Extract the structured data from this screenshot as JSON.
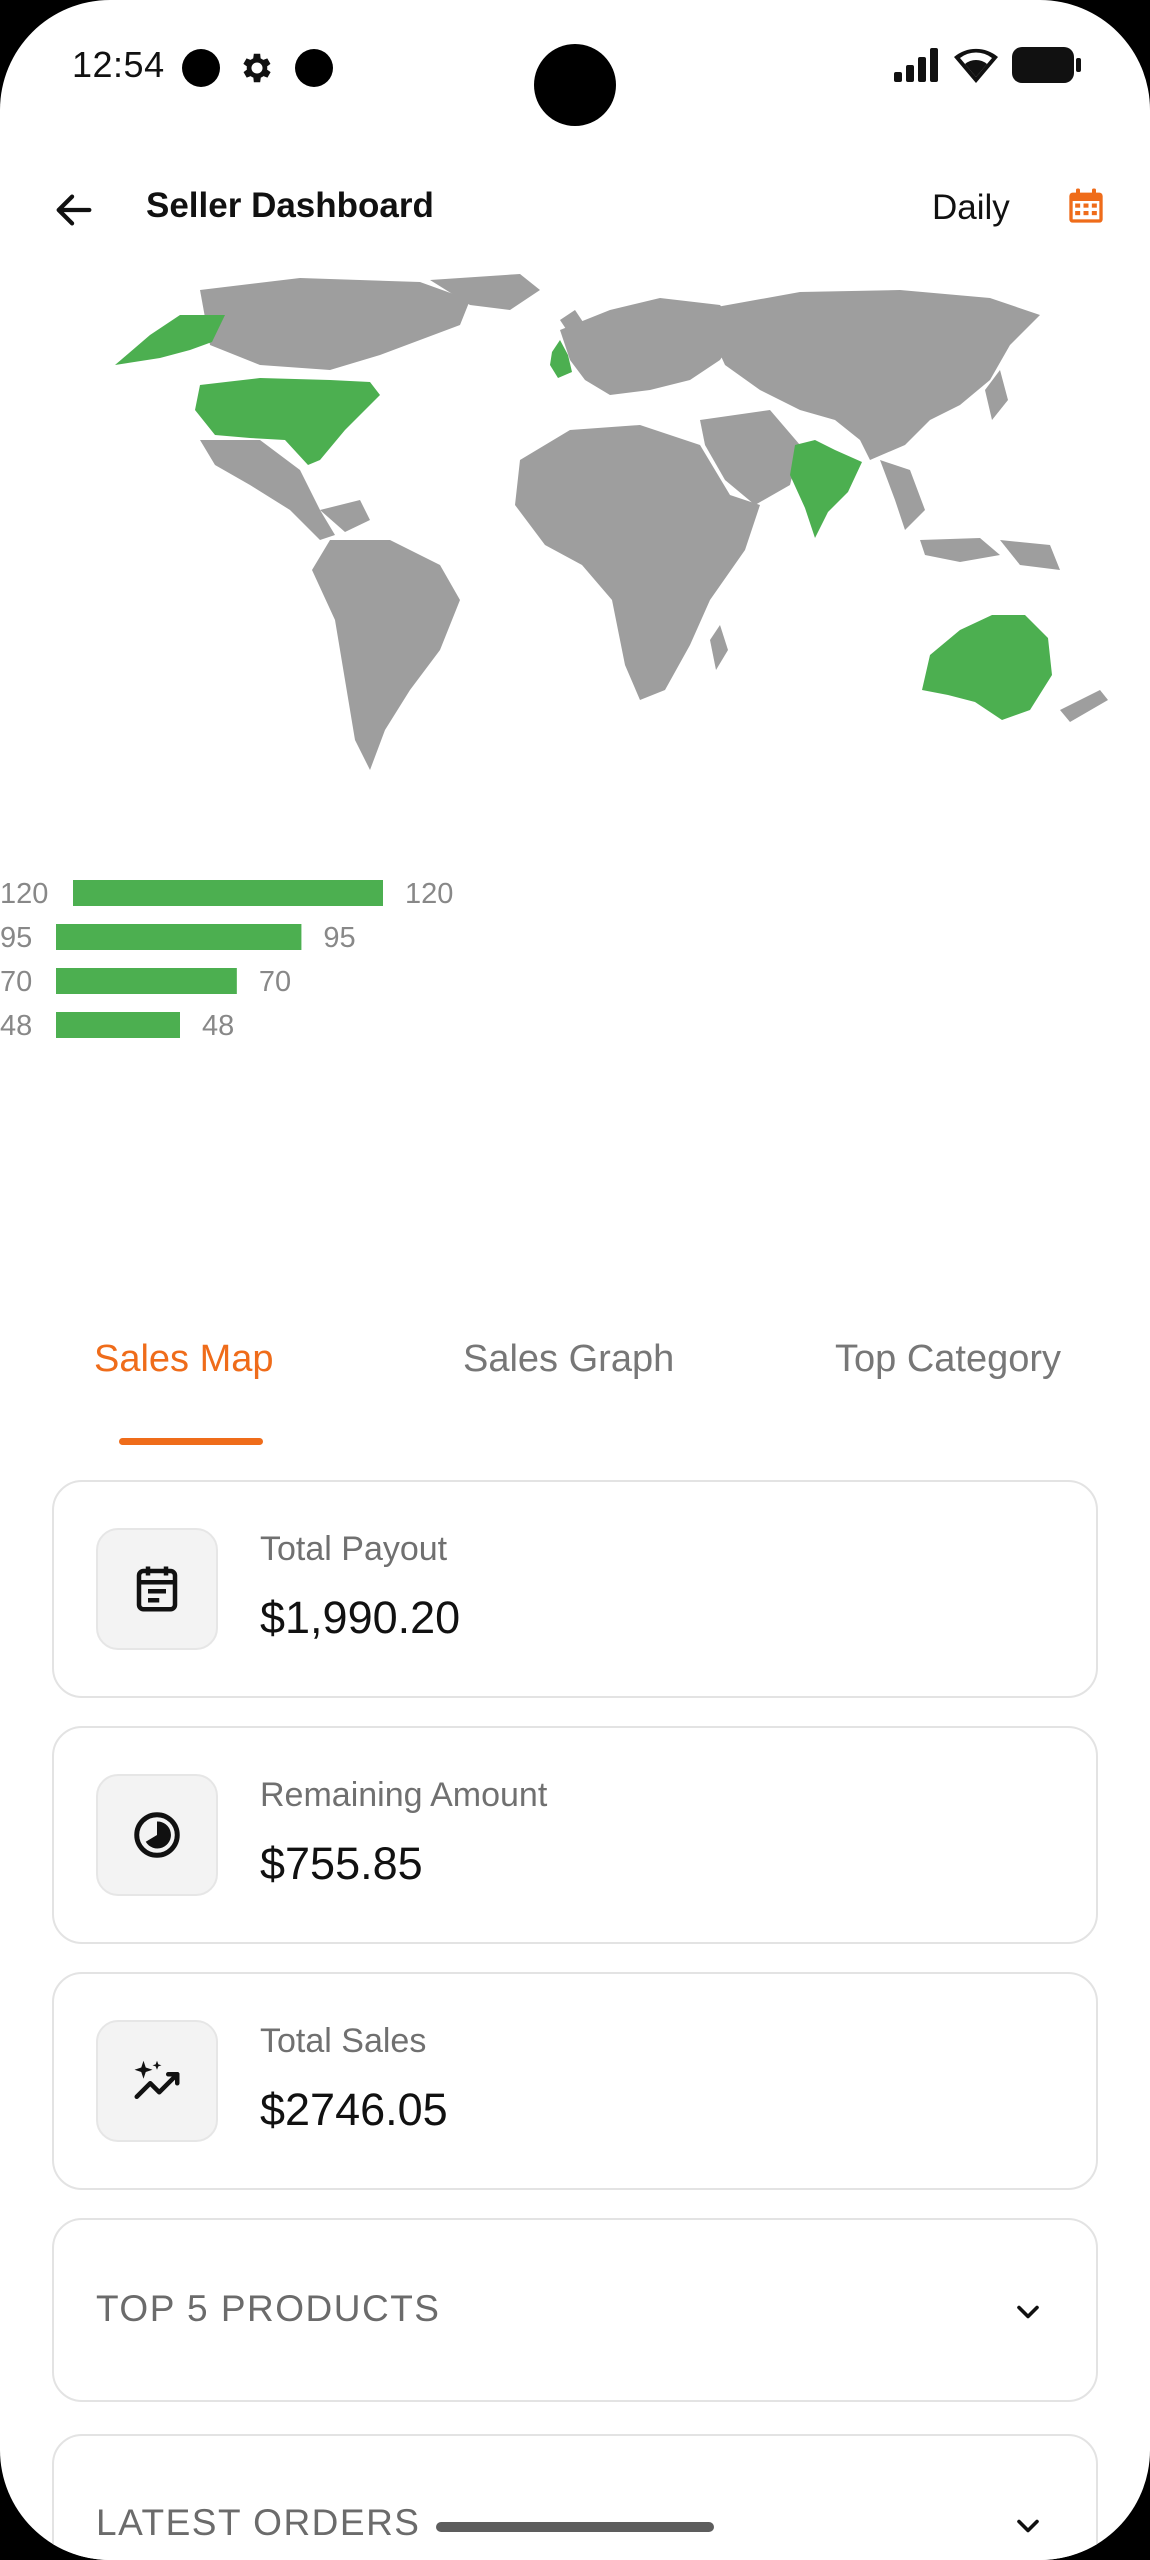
{
  "status_bar": {
    "time": "12:54",
    "icons": [
      "notification-dot",
      "gear-icon",
      "notification-dot",
      "signal-icon",
      "wifi-icon",
      "battery-icon"
    ]
  },
  "app_bar": {
    "title": "Seller Dashboard",
    "period": "Daily",
    "back_icon": "arrow-left-icon",
    "calendar_icon": "calendar-icon"
  },
  "map": {
    "highlight_color": "#4CAF50",
    "base_color": "#9E9E9E",
    "highlighted_regions": [
      "Alaska",
      "United States",
      "United Kingdom",
      "India",
      "Australia"
    ]
  },
  "chart_data": {
    "type": "bar",
    "orientation": "horizontal",
    "categories": [
      "120",
      "95",
      "70",
      "48"
    ],
    "values": [
      120,
      95,
      70,
      48
    ],
    "data_labels": [
      "120",
      "95",
      "70",
      "48"
    ],
    "color": "#4CAF50",
    "xlim": [
      0,
      120
    ]
  },
  "tabs": [
    {
      "label": "Sales Map",
      "active": true
    },
    {
      "label": "Sales Graph",
      "active": false
    },
    {
      "label": "Top Category",
      "active": false
    }
  ],
  "stats": [
    {
      "label": "Total Payout",
      "value": "$1,990.20",
      "icon": "calendar-note-icon"
    },
    {
      "label": "Remaining Amount",
      "value": "$755.85",
      "icon": "pie-chart-icon"
    },
    {
      "label": "Total Sales",
      "value": "$2746.05",
      "icon": "sparkle-trend-icon"
    }
  ],
  "sections": [
    {
      "title": "TOP 5 PRODUCTS",
      "icon": "chevron-down-icon"
    },
    {
      "title": "LATEST ORDERS",
      "icon": "chevron-down-icon"
    }
  ],
  "colors": {
    "accent": "#EF6C1A",
    "bar": "#4CAF50",
    "text": "#111111",
    "muted": "#707070"
  }
}
